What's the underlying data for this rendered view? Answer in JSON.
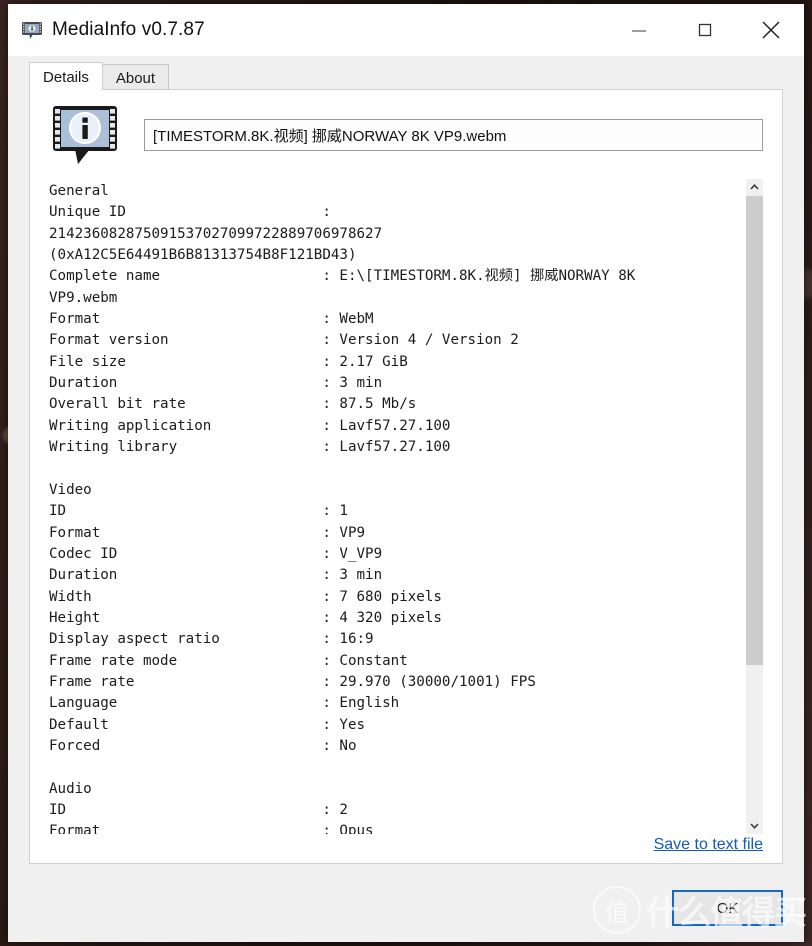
{
  "window": {
    "title": "MediaInfo v0.7.87",
    "icon": "mediainfo-logo-icon",
    "controls": {
      "minimize": "minimize-icon",
      "maximize": "maximize-icon",
      "close": "close-icon"
    }
  },
  "tabs": [
    {
      "label": "Details",
      "active": true
    },
    {
      "label": "About",
      "active": false
    }
  ],
  "file_field": {
    "value": "[TIMESTORM.8K.视频] 挪威NORWAY 8K VP9.webm",
    "placeholder": ""
  },
  "details": {
    "lines": [
      "General",
      "Unique ID                       :",
      "214236082875091537027099722889706978627",
      "(0xA12C5E64491B6B81313754B8F121BD43)",
      "Complete name                   : E:\\[TIMESTORM.8K.视频] 挪威NORWAY 8K",
      "VP9.webm",
      "Format                          : WebM",
      "Format version                  : Version 4 / Version 2",
      "File size                       : 2.17 GiB",
      "Duration                        : 3 min",
      "Overall bit rate                : 87.5 Mb/s",
      "Writing application             : Lavf57.27.100",
      "Writing library                 : Lavf57.27.100",
      "",
      "Video",
      "ID                              : 1",
      "Format                          : VP9",
      "Codec ID                        : V_VP9",
      "Duration                        : 3 min",
      "Width                           : 7 680 pixels",
      "Height                          : 4 320 pixels",
      "Display aspect ratio            : 16:9",
      "Frame rate mode                 : Constant",
      "Frame rate                      : 29.970 (30000/1001) FPS",
      "Language                        : English",
      "Default                         : Yes",
      "Forced                          : No",
      "",
      "Audio",
      "ID                              : 2",
      "Format                          : Opus"
    ],
    "scrollbar": {
      "up_arrow": "chevron-up-icon",
      "down_arrow": "chevron-down-icon",
      "thumb_fraction": "0.755"
    }
  },
  "save_link": {
    "label": "Save to text file"
  },
  "ok_button": {
    "label": "OK"
  },
  "watermark": {
    "mark": "值",
    "text": "什么值得买"
  },
  "colors": {
    "link": "#1458b8",
    "focus_border": "#1368c8",
    "window_bg": "#f0f0f0",
    "panel_bg": "#ffffff",
    "scrollbar_thumb": "#cdcdcd"
  }
}
